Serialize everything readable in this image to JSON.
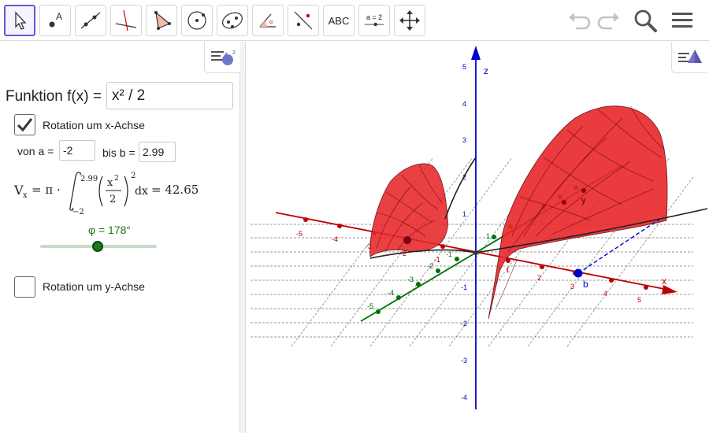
{
  "toolbar": {
    "tools": [
      {
        "name": "move-tool",
        "icon": "cursor-arrow-icon"
      },
      {
        "name": "point-tool",
        "icon": "point-icon"
      },
      {
        "name": "line-tool",
        "icon": "line-icon"
      },
      {
        "name": "perpendicular-line-tool",
        "icon": "perpendicular-icon"
      },
      {
        "name": "polygon-tool",
        "icon": "polygon-icon"
      },
      {
        "name": "circle-tool",
        "icon": "circle-icon"
      },
      {
        "name": "conic-tool",
        "icon": "ellipse-icon"
      },
      {
        "name": "angle-tool",
        "icon": "angle-icon"
      },
      {
        "name": "reflect-tool",
        "icon": "reflect-icon"
      },
      {
        "name": "text-tool",
        "label": "ABC"
      },
      {
        "name": "slider-tool",
        "label": "a = 2"
      },
      {
        "name": "move-graphics-tool",
        "icon": "move-arrows-icon"
      }
    ],
    "right": [
      "undo-icon",
      "redo-icon",
      "search-icon",
      "menu-icon"
    ]
  },
  "algebra": {
    "function_label": "Funktion f(x) =",
    "function_value": "x² / 2",
    "rotation_x": {
      "label": "Rotation um x-Achse",
      "checked": true
    },
    "von_label": "von a =",
    "a_value": "-2",
    "bis_label": "bis b =",
    "b_value": "2.99",
    "formula": {
      "lhs": "V",
      "sub": "x",
      "eq": "= π ·",
      "upper": "2.99",
      "lower": "−2",
      "num": "x",
      "num_exp": "2",
      "den": "2",
      "outer_exp": "2",
      "dx": "dx",
      "result": "= 42.65"
    },
    "slider": {
      "label": "φ = 178°",
      "value_deg": 178,
      "min_deg": 0,
      "max_deg": 360
    },
    "rotation_y": {
      "label": "Rotation um y-Achse",
      "checked": false
    }
  },
  "graphics3d": {
    "axis_labels": {
      "x": "x",
      "y": "y",
      "z": "z"
    },
    "point_label_b": "b",
    "x_ticks": [
      "-5",
      "-4",
      "-3",
      "-2",
      "-1",
      "1",
      "2",
      "3",
      "4",
      "5"
    ],
    "y_ticks": [
      "-5",
      "-4",
      "-3",
      "-2",
      "-1",
      "1",
      "2",
      "3",
      "4",
      "5"
    ],
    "z_ticks": [
      "5",
      "4",
      "3",
      "2",
      "1",
      "-1",
      "-2",
      "-3",
      "-4"
    ],
    "colors": {
      "x_axis": "#c00000",
      "y_axis": "#007000",
      "z_axis": "#0000cc",
      "surface": "#e8262b",
      "accent": "#6557d2"
    }
  }
}
